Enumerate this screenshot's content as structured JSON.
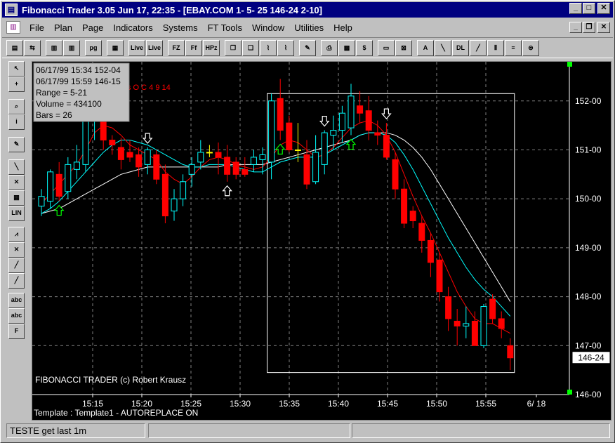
{
  "window": {
    "title": "Fibonacci Trader 3.05 Jun 17,  22:35 - [EBAY.COM  1-  5-  25 146-24    2-10]",
    "app_icon": "chart-icon"
  },
  "menu": {
    "items": [
      {
        "label": "File"
      },
      {
        "label": "Plan"
      },
      {
        "label": "Page"
      },
      {
        "label": "Indicators"
      },
      {
        "label": "Systems"
      },
      {
        "label": "FT Tools"
      },
      {
        "label": "Window"
      },
      {
        "label": "Utilities"
      },
      {
        "label": "Help"
      }
    ]
  },
  "toolbar": {
    "buttons": [
      {
        "name": "open-icon",
        "glyph": "▤"
      },
      {
        "name": "print-layout-icon",
        "glyph": "⇆"
      },
      {
        "name": "bar-chart-1-icon",
        "glyph": "▥"
      },
      {
        "name": "bar-chart-2-icon",
        "glyph": "▥"
      },
      {
        "name": "page-button",
        "glyph": "pg"
      },
      {
        "name": "grid-colors-icon",
        "glyph": "▦"
      },
      {
        "name": "live-range-1-button",
        "glyph": "Live"
      },
      {
        "name": "live-range-2-button",
        "glyph": "Live"
      },
      {
        "name": "fz-button",
        "glyph": "FZ"
      },
      {
        "name": "ff-button",
        "glyph": "Ff"
      },
      {
        "name": "hpz-button",
        "glyph": "HPz"
      },
      {
        "name": "cascade-icon",
        "glyph": "❐"
      },
      {
        "name": "add-window-icon",
        "glyph": "❏"
      },
      {
        "name": "chart-style-1-icon",
        "glyph": "⌇"
      },
      {
        "name": "chart-style-2-icon",
        "glyph": "⌇"
      },
      {
        "name": "draw-pen-icon",
        "glyph": "✎"
      },
      {
        "name": "printer-icon",
        "glyph": "⎙"
      },
      {
        "name": "calculator-icon",
        "glyph": "▩"
      },
      {
        "name": "dollar-icon",
        "glyph": "$"
      },
      {
        "name": "memo-icon",
        "glyph": "▭"
      },
      {
        "name": "delete-icon",
        "glyph": "⊠"
      },
      {
        "name": "trend-up-icon",
        "glyph": "A"
      },
      {
        "name": "trend-down-icon",
        "glyph": "╲"
      },
      {
        "name": "dl-button",
        "glyph": "DL"
      },
      {
        "name": "diagonal-line-icon",
        "glyph": "╱"
      },
      {
        "name": "vertical-lines-icon",
        "glyph": "⦀"
      },
      {
        "name": "horizontal-lines-icon",
        "glyph": "≡"
      },
      {
        "name": "channel-icon",
        "glyph": "⊜"
      }
    ]
  },
  "left_tools": [
    {
      "name": "pointer-icon",
      "glyph": "↖"
    },
    {
      "name": "crosshair-icon",
      "glyph": "+"
    },
    {
      "name": "zoom-icon",
      "glyph": "⌕"
    },
    {
      "name": "info-icon",
      "glyph": "i"
    },
    {
      "name": "pencil-icon",
      "glyph": "✎"
    },
    {
      "name": "trendline-icon",
      "glyph": "╲"
    },
    {
      "name": "cross-out-icon",
      "glyph": "✕"
    },
    {
      "name": "grid-icon",
      "glyph": "▦"
    },
    {
      "name": "lin-button",
      "glyph": "LIN"
    },
    {
      "name": "fib-draw-icon",
      "glyph": "⩘"
    },
    {
      "name": "fib-delete-icon",
      "glyph": "✕"
    },
    {
      "name": "line-tool-1-icon",
      "glyph": "╱"
    },
    {
      "name": "line-tool-2-icon",
      "glyph": "╱"
    },
    {
      "name": "text-button",
      "glyph": "abc"
    },
    {
      "name": "text-delete-button",
      "glyph": "abc"
    },
    {
      "name": "font-button",
      "glyph": "F"
    }
  ],
  "info_box": {
    "line1": "06/17/99 15:34  152-04",
    "line2": "06/17/99 15:59  146-15",
    "line3": "Range =  5-21",
    "line4": "Volume = 434100",
    "line5": "Bars = 26"
  },
  "chart_overlay_text": "s O C 4 9 14",
  "chart_footer_copyright": "FIBONACCI TRADER (c) Robert Krausz",
  "chart_footer_template": "Template : Template1 - AUTOREPLACE ON",
  "colors": {
    "background": "#000000",
    "up_candle": "#00ffff",
    "down_candle": "#ff0000",
    "neutral_candle": "#ffff00",
    "ma_fast": "#ff0000",
    "ma_mid": "#00ffff",
    "ma_slow": "#ffffff",
    "grid": "#808080"
  },
  "chart_data": {
    "type": "candlestick",
    "ylim": [
      146.0,
      152.8
    ],
    "y_ticks": [
      {
        "value": 146.0,
        "label": "146-00"
      },
      {
        "value": 147.0,
        "label": "147-00"
      },
      {
        "value": 148.0,
        "label": "148-00"
      },
      {
        "value": 149.0,
        "label": "149-00"
      },
      {
        "value": 150.0,
        "label": "150-00"
      },
      {
        "value": 151.0,
        "label": "151-00"
      },
      {
        "value": 152.0,
        "label": "152-00"
      }
    ],
    "x_ticks": [
      "15:15",
      "15:20",
      "15:25",
      "15:30",
      "15:35",
      "15:40",
      "15:45",
      "15:50",
      "15:55",
      "6/ 18"
    ],
    "last_price_label": "146-24",
    "last_price": 146.75,
    "candles": [
      {
        "o": 149.85,
        "h": 150.2,
        "l": 149.65,
        "c": 150.05
      },
      {
        "o": 149.95,
        "h": 150.6,
        "l": 149.8,
        "c": 150.55
      },
      {
        "o": 150.5,
        "h": 150.75,
        "l": 149.95,
        "c": 150.05
      },
      {
        "o": 150.15,
        "h": 150.85,
        "l": 150.0,
        "c": 150.7
      },
      {
        "o": 150.6,
        "h": 151.1,
        "l": 150.4,
        "c": 150.75
      },
      {
        "o": 150.7,
        "h": 151.8,
        "l": 150.55,
        "c": 151.65
      },
      {
        "o": 151.6,
        "h": 152.05,
        "l": 151.2,
        "c": 151.85
      },
      {
        "o": 151.85,
        "h": 152.15,
        "l": 151.0,
        "c": 151.2
      },
      {
        "o": 151.2,
        "h": 151.3,
        "l": 150.9,
        "c": 151.1
      },
      {
        "o": 151.05,
        "h": 151.25,
        "l": 150.6,
        "c": 150.8
      },
      {
        "o": 150.95,
        "h": 151.2,
        "l": 150.75,
        "c": 150.85
      },
      {
        "o": 150.9,
        "h": 151.05,
        "l": 150.45,
        "c": 150.65
      },
      {
        "o": 150.7,
        "h": 151.05,
        "l": 150.5,
        "c": 151.0
      },
      {
        "o": 150.9,
        "h": 151.0,
        "l": 150.3,
        "c": 150.4
      },
      {
        "o": 150.5,
        "h": 150.7,
        "l": 149.5,
        "c": 149.65
      },
      {
        "o": 149.75,
        "h": 150.2,
        "l": 149.55,
        "c": 150.0
      },
      {
        "o": 150.0,
        "h": 150.5,
        "l": 149.85,
        "c": 150.35
      },
      {
        "o": 150.5,
        "h": 150.85,
        "l": 150.25,
        "c": 150.7
      },
      {
        "o": 150.75,
        "h": 151.2,
        "l": 150.6,
        "c": 150.95
      },
      {
        "o": 150.95,
        "h": 151.1,
        "l": 150.85,
        "c": 150.95
      },
      {
        "o": 150.95,
        "h": 151.15,
        "l": 150.5,
        "c": 150.85
      },
      {
        "o": 150.85,
        "h": 151.1,
        "l": 150.35,
        "c": 150.5
      },
      {
        "o": 150.75,
        "h": 150.85,
        "l": 150.4,
        "c": 150.5
      },
      {
        "o": 150.6,
        "h": 150.85,
        "l": 150.45,
        "c": 150.5
      },
      {
        "o": 150.7,
        "h": 151.0,
        "l": 150.55,
        "c": 150.85
      },
      {
        "o": 150.8,
        "h": 151.05,
        "l": 150.5,
        "c": 150.9
      },
      {
        "o": 150.75,
        "h": 152.15,
        "l": 150.4,
        "c": 152.0
      },
      {
        "o": 152.05,
        "h": 152.45,
        "l": 151.2,
        "c": 151.4
      },
      {
        "o": 151.55,
        "h": 151.7,
        "l": 150.95,
        "c": 151.0
      },
      {
        "o": 151.0,
        "h": 151.55,
        "l": 150.75,
        "c": 151.0
      },
      {
        "o": 150.9,
        "h": 151.2,
        "l": 150.2,
        "c": 150.3
      },
      {
        "o": 150.35,
        "h": 151.3,
        "l": 150.3,
        "c": 150.95
      },
      {
        "o": 150.7,
        "h": 151.4,
        "l": 150.5,
        "c": 151.35
      },
      {
        "o": 151.3,
        "h": 151.7,
        "l": 151.0,
        "c": 151.4
      },
      {
        "o": 151.4,
        "h": 151.9,
        "l": 151.15,
        "c": 151.75
      },
      {
        "o": 151.45,
        "h": 152.35,
        "l": 151.3,
        "c": 152.1
      },
      {
        "o": 151.9,
        "h": 152.2,
        "l": 151.55,
        "c": 151.75
      },
      {
        "o": 151.8,
        "h": 152.1,
        "l": 151.2,
        "c": 151.4
      },
      {
        "o": 151.35,
        "h": 151.6,
        "l": 151.1,
        "c": 151.3
      },
      {
        "o": 151.3,
        "h": 151.55,
        "l": 150.8,
        "c": 150.85
      },
      {
        "o": 150.8,
        "h": 150.95,
        "l": 150.0,
        "c": 150.2
      },
      {
        "o": 150.2,
        "h": 150.4,
        "l": 149.4,
        "c": 149.5
      },
      {
        "o": 149.75,
        "h": 149.85,
        "l": 149.4,
        "c": 149.55
      },
      {
        "o": 149.5,
        "h": 149.65,
        "l": 148.9,
        "c": 149.15
      },
      {
        "o": 149.15,
        "h": 149.3,
        "l": 148.4,
        "c": 148.7
      },
      {
        "o": 148.75,
        "h": 148.9,
        "l": 147.9,
        "c": 148.1
      },
      {
        "o": 148.0,
        "h": 148.2,
        "l": 147.3,
        "c": 147.55
      },
      {
        "o": 147.5,
        "h": 147.75,
        "l": 147.0,
        "c": 147.4
      },
      {
        "o": 147.4,
        "h": 147.8,
        "l": 147.15,
        "c": 147.45
      },
      {
        "o": 147.5,
        "h": 147.7,
        "l": 147.0,
        "c": 147.0
      },
      {
        "o": 147.0,
        "h": 147.85,
        "l": 146.95,
        "c": 147.8
      },
      {
        "o": 147.95,
        "h": 148.05,
        "l": 147.45,
        "c": 147.55
      },
      {
        "o": 147.55,
        "h": 147.7,
        "l": 147.15,
        "c": 147.35
      },
      {
        "o": 147.0,
        "h": 147.15,
        "l": 146.5,
        "c": 146.75
      }
    ],
    "ma_fast": [
      149.9,
      150.1,
      150.3,
      150.5,
      150.7,
      151.0,
      151.35,
      151.5,
      151.45,
      151.3,
      151.1,
      151.0,
      150.9,
      150.8,
      150.55,
      150.4,
      150.3,
      150.45,
      150.65,
      150.8,
      150.85,
      150.8,
      150.7,
      150.65,
      150.6,
      150.65,
      150.85,
      151.1,
      151.2,
      151.15,
      151.0,
      150.85,
      150.9,
      151.05,
      151.25,
      151.45,
      151.55,
      151.6,
      151.5,
      151.3,
      150.95,
      150.5,
      150.05,
      149.65,
      149.3,
      148.9,
      148.5,
      148.1,
      147.8,
      147.55,
      147.45,
      147.45,
      147.35,
      147.25
    ],
    "ma_mid": [
      149.7,
      149.8,
      149.95,
      150.15,
      150.35,
      150.55,
      150.75,
      150.95,
      151.1,
      151.2,
      151.2,
      151.15,
      151.1,
      151.0,
      150.9,
      150.8,
      150.7,
      150.65,
      150.65,
      150.7,
      150.7,
      150.7,
      150.65,
      150.6,
      150.55,
      150.55,
      150.65,
      150.75,
      150.8,
      150.85,
      150.85,
      150.85,
      150.9,
      151.0,
      151.1,
      151.2,
      151.3,
      151.35,
      151.35,
      151.3,
      151.15,
      150.9,
      150.6,
      150.25,
      149.9,
      149.55,
      149.2,
      148.9,
      148.6,
      148.35,
      148.15,
      148.0,
      147.8,
      147.6
    ],
    "ma_slow": [
      149.7,
      149.75,
      149.8,
      149.9,
      150.0,
      150.1,
      150.2,
      150.3,
      150.4,
      150.5,
      150.55,
      150.6,
      150.65,
      150.65,
      150.65,
      150.65,
      150.65,
      150.65,
      150.65,
      150.65,
      150.65,
      150.7,
      150.7,
      150.7,
      150.7,
      150.7,
      150.75,
      150.8,
      150.85,
      150.9,
      150.95,
      151.0,
      151.05,
      151.1,
      151.15,
      151.2,
      151.3,
      151.35,
      151.35,
      151.35,
      151.3,
      151.2,
      151.05,
      150.85,
      150.6,
      150.3,
      150.0,
      149.7,
      149.4,
      149.1,
      148.8,
      148.5,
      148.2,
      147.9
    ],
    "arrows": [
      {
        "bar": 2,
        "type": "up",
        "color": "#00ff00"
      },
      {
        "bar": 12,
        "type": "down",
        "color": "#ffffff"
      },
      {
        "bar": 21,
        "type": "up",
        "color": "#ffffff"
      },
      {
        "bar": 27,
        "type": "up",
        "color": "#00ff00"
      },
      {
        "bar": 32,
        "type": "down",
        "color": "#ffffff"
      },
      {
        "bar": 35,
        "type": "up",
        "color": "#00ff00"
      },
      {
        "bar": 39,
        "type": "down",
        "color": "#ffffff"
      }
    ]
  },
  "status": {
    "left": "TESTE get last 1m",
    "middle": "",
    "right": ""
  }
}
